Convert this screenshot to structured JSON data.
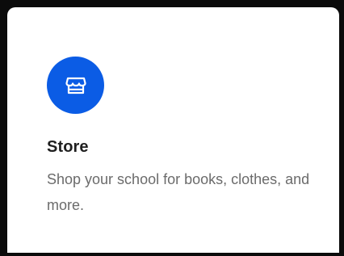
{
  "card": {
    "title": "Store",
    "description": "Shop your school for books, clothes, and more.",
    "icon": "storefront-icon",
    "accent_color": "#0b5ce5"
  }
}
